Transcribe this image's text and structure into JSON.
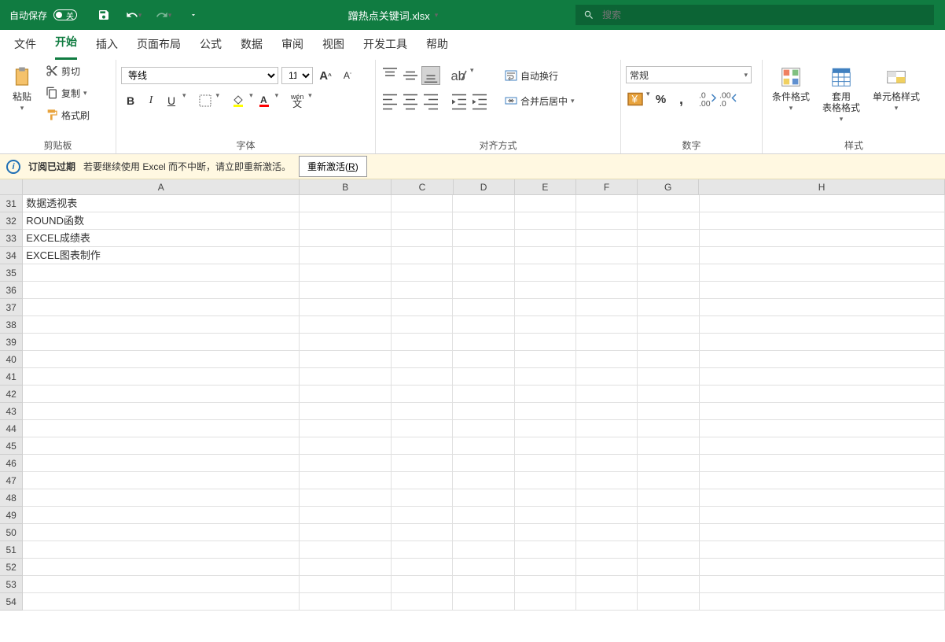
{
  "titlebar": {
    "autosave_label": "自动保存",
    "autosave_state": "关",
    "filename": "蹭热点关键词.xlsx",
    "search_placeholder": "搜索"
  },
  "tabs": [
    "文件",
    "开始",
    "插入",
    "页面布局",
    "公式",
    "数据",
    "审阅",
    "视图",
    "开发工具",
    "帮助"
  ],
  "active_tab_index": 1,
  "ribbon": {
    "clipboard": {
      "label": "剪贴板",
      "paste": "粘贴",
      "cut": "剪切",
      "copy": "复制",
      "format_painter": "格式刷"
    },
    "font": {
      "label": "字体",
      "name": "等线",
      "size": "11",
      "bold": "B",
      "italic": "I",
      "underline": "U",
      "pinyin": "wén",
      "fill_color": "#FFFF00",
      "font_color": "#FF0000"
    },
    "align": {
      "label": "对齐方式",
      "wrap": "自动换行",
      "merge": "合并后居中"
    },
    "number": {
      "label": "数字",
      "format": "常规"
    },
    "styles": {
      "label": "样式",
      "cond": "条件格式",
      "table": "套用\n表格格式",
      "cell": "单元格样式"
    }
  },
  "msgbar": {
    "title": "订阅已过期",
    "text": "若要继续使用 Excel 而不中断，请立即重新激活。",
    "button": "重新激活(",
    "button_key": "R",
    "button_end": ")"
  },
  "columns": [
    "A",
    "B",
    "C",
    "D",
    "E",
    "F",
    "G",
    "H"
  ],
  "rows": [
    {
      "num": 31,
      "A": "数据透视表"
    },
    {
      "num": 32,
      "A": "ROUND函数"
    },
    {
      "num": 33,
      "A": "EXCEL成绩表"
    },
    {
      "num": 34,
      "A": "EXCEL图表制作"
    },
    {
      "num": 35,
      "A": ""
    },
    {
      "num": 36,
      "A": ""
    },
    {
      "num": 37,
      "A": ""
    },
    {
      "num": 38,
      "A": ""
    },
    {
      "num": 39,
      "A": ""
    },
    {
      "num": 40,
      "A": ""
    },
    {
      "num": 41,
      "A": ""
    },
    {
      "num": 42,
      "A": ""
    },
    {
      "num": 43,
      "A": ""
    },
    {
      "num": 44,
      "A": ""
    },
    {
      "num": 45,
      "A": ""
    },
    {
      "num": 46,
      "A": ""
    },
    {
      "num": 47,
      "A": ""
    },
    {
      "num": 48,
      "A": ""
    },
    {
      "num": 49,
      "A": ""
    },
    {
      "num": 50,
      "A": ""
    },
    {
      "num": 51,
      "A": ""
    },
    {
      "num": 52,
      "A": ""
    },
    {
      "num": 53,
      "A": ""
    },
    {
      "num": 54,
      "A": ""
    }
  ]
}
